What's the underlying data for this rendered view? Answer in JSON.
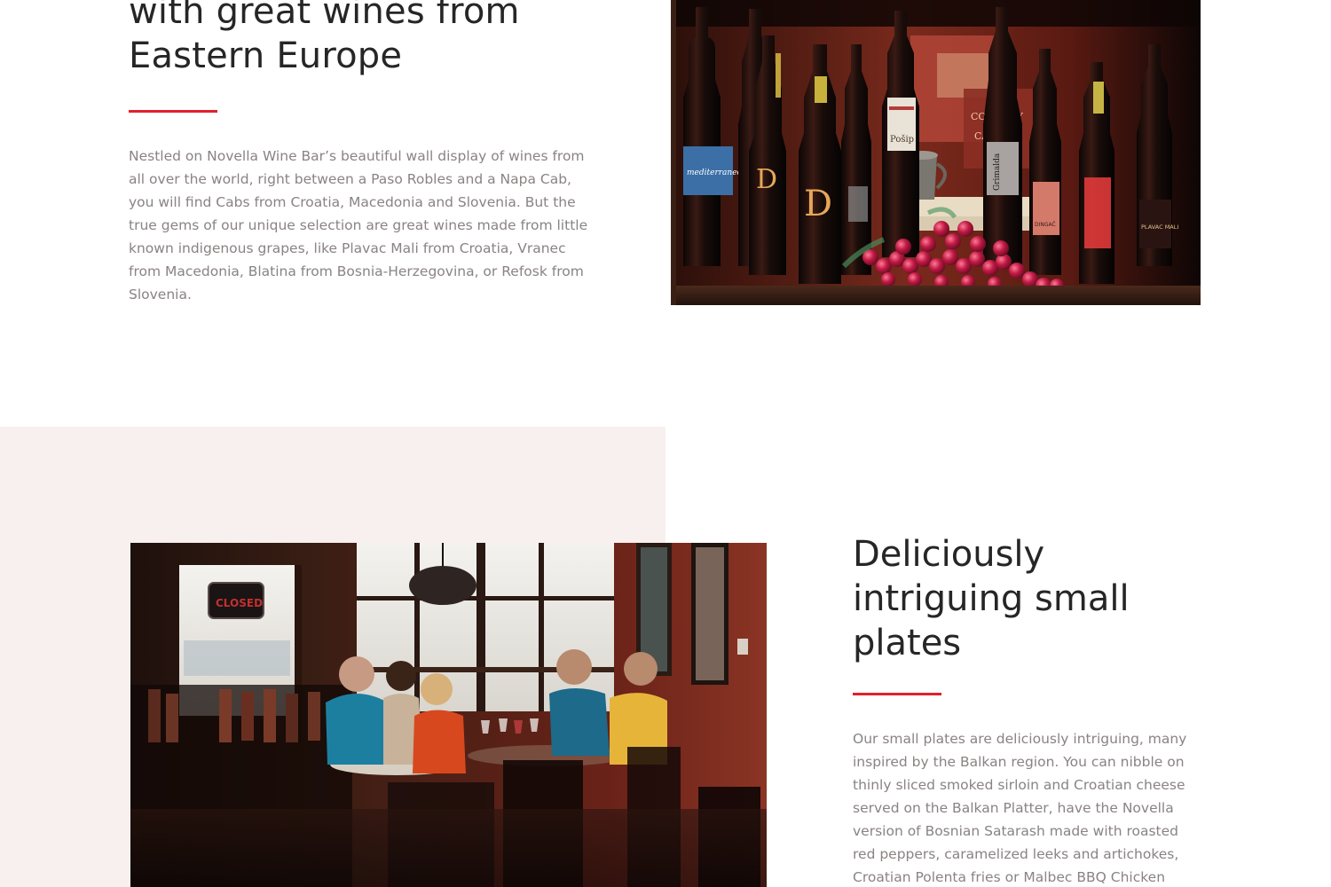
{
  "wines_section": {
    "heading": "with great wines from Eastern Europe",
    "body": "Nestled on Novella Wine Bar’s beautiful wall display of wines from all over the world, right between a Paso Robles and a Napa Cab, you will find Cabs from Croatia, Macedonia and Slovenia. But the true gems of our unique selection are great wines made from little known indigenous grapes, like Plavac Mali from Croatia, Vranec from Macedonia, Blatina from Bosnia-Herzegovina, or Refosk from Slovenia.",
    "photo": {
      "label_mediterraneo": "mediterraneo",
      "label_pošip": "Pošip",
      "label_country": "COUNTRY",
      "label_called": "CALLED",
      "label_grimalda": "Grimalda",
      "label_plavac_mali": "PLAVAC MALI",
      "label_dingac": "DINGAČ"
    }
  },
  "small_plates_section": {
    "heading": "Deliciously intriguing small plates",
    "body": "Our small plates are deliciously intriguing, many inspired by the Balkan region. You can nibble on thinly sliced smoked sirloin and Croatian cheese served on the Balkan Platter, have the Novella version of Bosnian Satarash made with roasted red peppers, caramelized leeks and artichokes, Croatian Polenta fries or Malbec BBQ Chicken",
    "photo": {
      "door_sign": "CLOSED"
    }
  },
  "colors": {
    "accent": "#e2202c",
    "heading": "#262626",
    "body_text": "#8a8383",
    "section_bg": "#f8f0ee"
  }
}
